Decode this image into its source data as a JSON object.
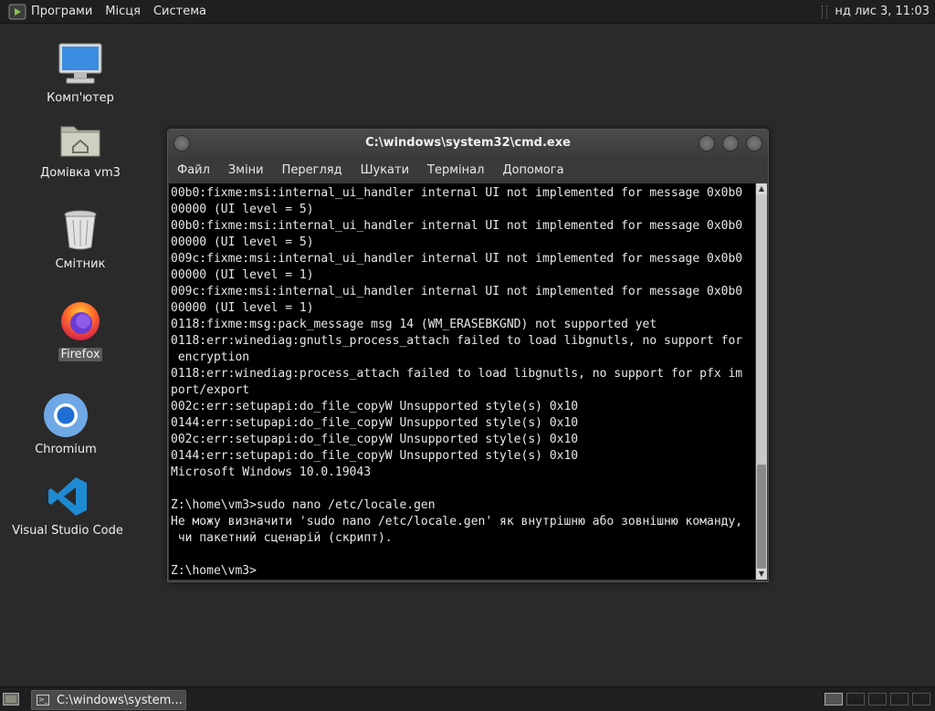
{
  "top_panel": {
    "menu_programs": "Програми",
    "menu_places": "Місця",
    "menu_system": "Система",
    "clock": "нд лис 3, 11:03",
    "logo_icon": "terminal-play-icon"
  },
  "desktop": {
    "icons": [
      {
        "label": "Комп'ютер",
        "icon": "computer-icon"
      },
      {
        "label": "Домівка vm3",
        "icon": "home-folder-icon"
      },
      {
        "label": "Смітник",
        "icon": "trash-icon"
      },
      {
        "label": "Firefox",
        "icon": "firefox-icon"
      },
      {
        "label": "Chromium",
        "icon": "chromium-icon"
      },
      {
        "label": "Visual Studio Code",
        "icon": "vscode-icon"
      }
    ]
  },
  "window": {
    "title": "C:\\windows\\system32\\cmd.exe",
    "menu": {
      "file": "Файл",
      "edit": "Зміни",
      "view": "Перегляд",
      "search": "Шукати",
      "terminal": "Термінал",
      "help": "Допомога"
    },
    "terminal_text": "00b0:fixme:msi:internal_ui_handler internal UI not implemented for message 0x0b0\n00000 (UI level = 5)\n00b0:fixme:msi:internal_ui_handler internal UI not implemented for message 0x0b0\n00000 (UI level = 5)\n009c:fixme:msi:internal_ui_handler internal UI not implemented for message 0x0b0\n00000 (UI level = 1)\n009c:fixme:msi:internal_ui_handler internal UI not implemented for message 0x0b0\n00000 (UI level = 1)\n0118:fixme:msg:pack_message msg 14 (WM_ERASEBKGND) not supported yet\n0118:err:winediag:gnutls_process_attach failed to load libgnutls, no support for\n encryption\n0118:err:winediag:process_attach failed to load libgnutls, no support for pfx im\nport/export\n002c:err:setupapi:do_file_copyW Unsupported style(s) 0x10\n0144:err:setupapi:do_file_copyW Unsupported style(s) 0x10\n002c:err:setupapi:do_file_copyW Unsupported style(s) 0x10\n0144:err:setupapi:do_file_copyW Unsupported style(s) 0x10\nMicrosoft Windows 10.0.19043\n\nZ:\\home\\vm3>sudo nano /etc/locale.gen\nНе можу визначити 'sudo nano /etc/locale.gen' як внутрішню або зовнішню команду,\n чи пакетний сценарій (скрипт).\n\nZ:\\home\\vm3>"
  },
  "taskbar": {
    "task_label": "C:\\windows\\system...",
    "show_desktop_icon": "show-desktop-icon"
  },
  "colors": {
    "desktop_bg": "#2a2a2a",
    "panel_bg": "#1f1f1f",
    "terminal_bg": "#000000",
    "terminal_fg": "#e8e8e8"
  }
}
